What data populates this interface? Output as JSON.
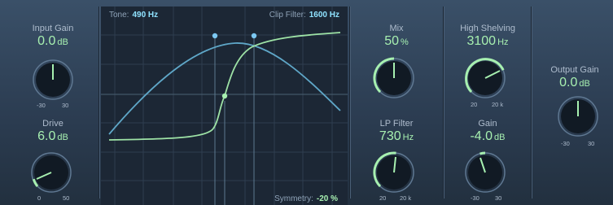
{
  "plugin": {
    "input_gain": {
      "label": "Input Gain",
      "value": "0.0",
      "unit": "dB"
    },
    "drive": {
      "label": "Drive",
      "value": "6.0",
      "unit": "dB",
      "scale_min": "0",
      "scale_max": "50"
    },
    "input_scale": {
      "min": "-30",
      "max": "30"
    },
    "graph": {
      "tone_label": "Tone:",
      "tone_value": "490 Hz",
      "clip_label": "Clip Filter:",
      "clip_value": "1600 Hz",
      "symmetry_label": "Symmetry:",
      "symmetry_value": "-20 %"
    },
    "mix": {
      "label": "Mix",
      "value": "50",
      "unit": "%"
    },
    "lp_filter": {
      "label": "LP Filter",
      "value": "730",
      "unit": "Hz",
      "scale_min": "20",
      "scale_max": "20 k"
    },
    "high_shelving": {
      "label": "High Shelving",
      "value": "3100",
      "unit": "Hz",
      "scale_min": "20",
      "scale_max": "20 k"
    },
    "gain": {
      "label": "Gain",
      "value": "-4.0",
      "unit": "dB",
      "scale_min": "-30",
      "scale_max": "30"
    },
    "output_gain": {
      "label": "Output Gain",
      "value": "0.0",
      "unit": "dB",
      "scale_min": "-30",
      "scale_max": "30"
    }
  },
  "colors": {
    "accent": "#a7f0b0",
    "cyan": "#8fe2ff",
    "background": "#2c3d52"
  }
}
